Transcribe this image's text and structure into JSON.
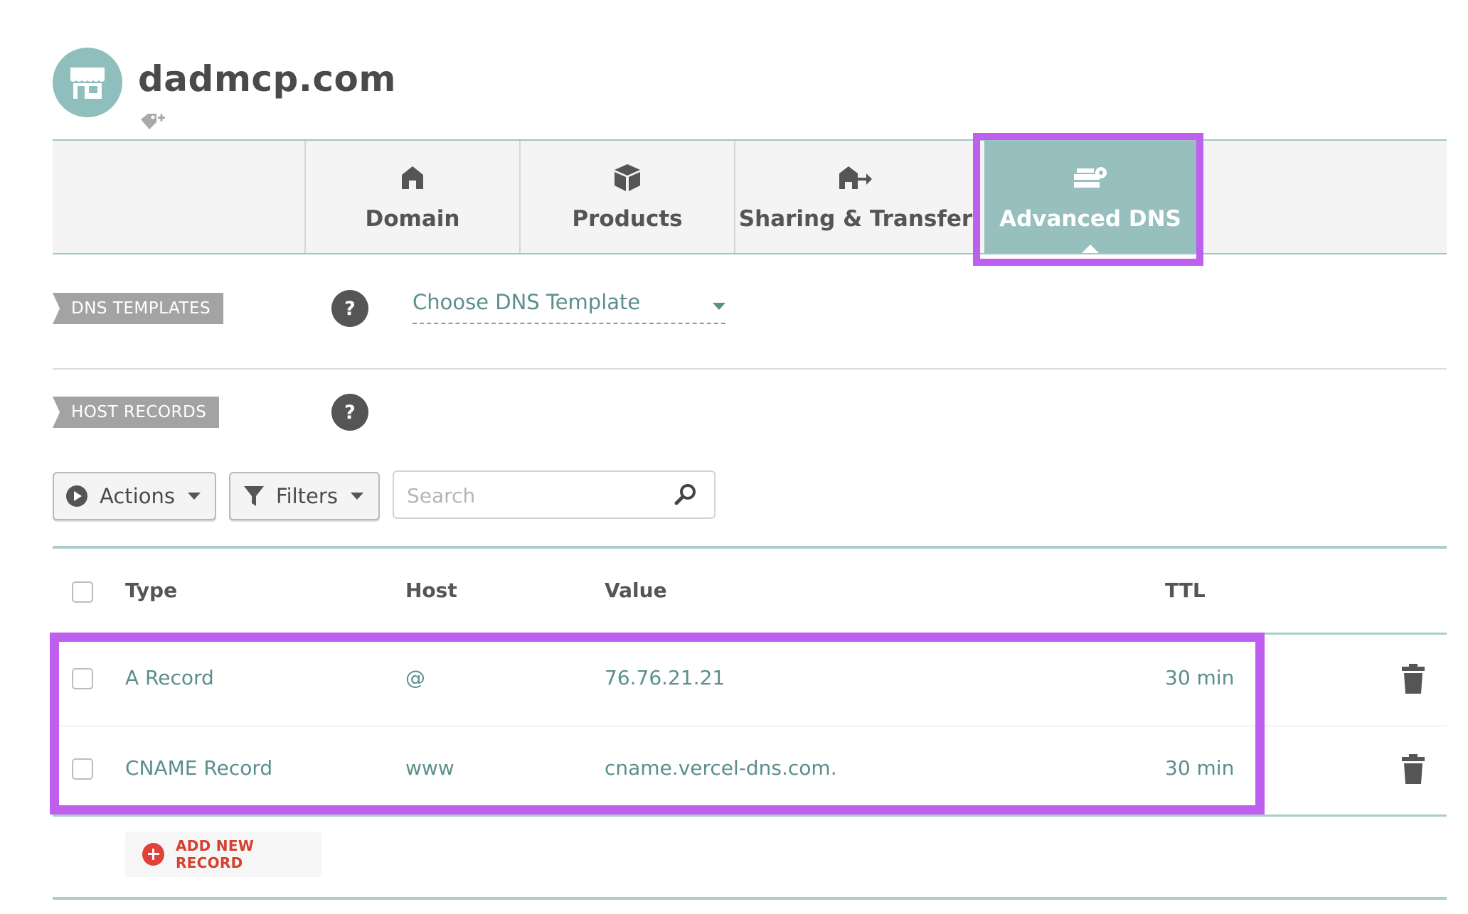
{
  "header": {
    "domain": "dadmcp.com"
  },
  "tabs": [
    {
      "label": "Domain",
      "icon": "house-icon"
    },
    {
      "label": "Products",
      "icon": "box-icon"
    },
    {
      "label": "Sharing & Transfer",
      "icon": "house-transfer-icon"
    },
    {
      "label": "Advanced DNS",
      "icon": "server-gear-icon",
      "active": true
    }
  ],
  "dns_templates": {
    "label": "DNS TEMPLATES",
    "help": "?",
    "select_value": "Choose DNS Template"
  },
  "host_records": {
    "label": "HOST RECORDS",
    "help": "?"
  },
  "toolbar": {
    "actions_label": "Actions",
    "filters_label": "Filters",
    "search_placeholder": "Search"
  },
  "table": {
    "columns": [
      "Type",
      "Host",
      "Value",
      "TTL"
    ],
    "rows": [
      {
        "type": "A Record",
        "host": "@",
        "value": "76.76.21.21",
        "ttl": "30 min"
      },
      {
        "type": "CNAME Record",
        "host": "www",
        "value": "cname.vercel-dns.com.",
        "ttl": "30 min"
      }
    ]
  },
  "add_record_label": "ADD NEW RECORD",
  "colors": {
    "accent": "#96bfbd",
    "highlight": "#bf5ff0",
    "add": "#d4412f",
    "link": "#5a8f8c"
  }
}
